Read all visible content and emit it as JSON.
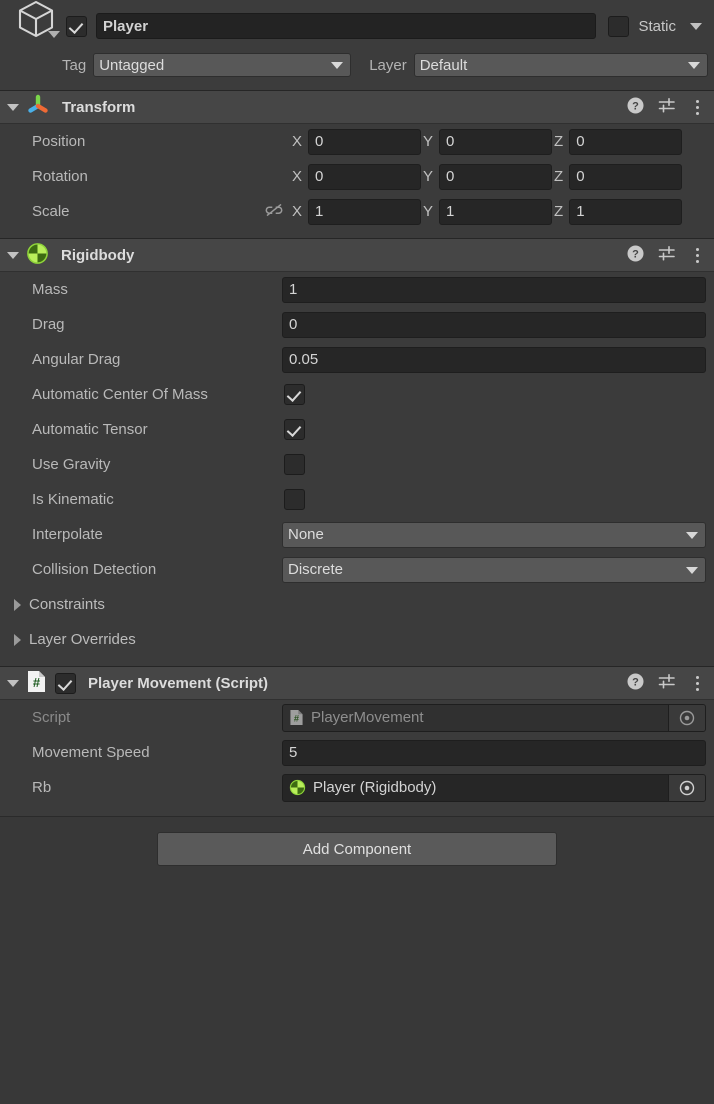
{
  "object_header": {
    "icon": "gameobject-cube-icon",
    "enabled": true,
    "name": "Player",
    "static_checked": false,
    "static_label": "Static",
    "tag_label": "Tag",
    "tag_value": "Untagged",
    "layer_label": "Layer",
    "layer_value": "Default"
  },
  "components": [
    {
      "title": "Transform",
      "icon": "transform-axis-icon",
      "expanded": true,
      "rows": [
        {
          "label": "Position",
          "x": "0",
          "y": "0",
          "z": "0",
          "link": false
        },
        {
          "label": "Rotation",
          "x": "0",
          "y": "0",
          "z": "0",
          "link": false
        },
        {
          "label": "Scale",
          "x": "1",
          "y": "1",
          "z": "1",
          "link": true
        }
      ],
      "axes": {
        "x": "X",
        "y": "Y",
        "z": "Z"
      }
    },
    {
      "title": "Rigidbody",
      "icon": "rigidbody-icon",
      "expanded": true,
      "props": [
        {
          "label": "Mass",
          "type": "number",
          "value": "1"
        },
        {
          "label": "Drag",
          "type": "number",
          "value": "0"
        },
        {
          "label": "Angular Drag",
          "type": "number",
          "value": "0.05"
        },
        {
          "label": "Automatic Center Of Mass",
          "type": "checkbox",
          "checked": true
        },
        {
          "label": "Automatic Tensor",
          "type": "checkbox",
          "checked": true
        },
        {
          "label": "Use Gravity",
          "type": "checkbox",
          "checked": false
        },
        {
          "label": "Is Kinematic",
          "type": "checkbox",
          "checked": false
        },
        {
          "label": "Interpolate",
          "type": "dropdown",
          "value": "None"
        },
        {
          "label": "Collision Detection",
          "type": "dropdown",
          "value": "Discrete"
        },
        {
          "label": "Constraints",
          "type": "foldout"
        },
        {
          "label": "Layer Overrides",
          "type": "foldout"
        }
      ]
    },
    {
      "title": "Player Movement (Script)",
      "icon": "csharp-script-icon",
      "expanded": true,
      "enabled": true,
      "props": [
        {
          "label": "Script",
          "type": "object",
          "value": "PlayerMovement",
          "icon": "csharp-script-icon",
          "dim": true
        },
        {
          "label": "Movement Speed",
          "type": "number",
          "value": "5"
        },
        {
          "label": "Rb",
          "type": "object",
          "value": "Player (Rigidbody)",
          "icon": "rigidbody-icon",
          "dim": false
        }
      ]
    }
  ],
  "footer": {
    "add_component_label": "Add Component"
  },
  "header_icons": {
    "help": "help-icon",
    "preset": "preset-icon",
    "menu": "kebab-menu-icon"
  },
  "colors": {
    "panel_bg": "#383838",
    "component_header_bg": "#464646",
    "field_bg": "#262626",
    "dropdown_bg": "#585858",
    "accent_green": "#aaeb4c",
    "text": "#c4c4c4"
  }
}
